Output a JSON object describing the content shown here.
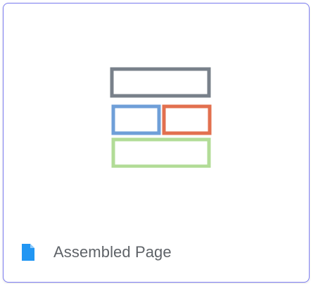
{
  "card": {
    "title": "Assembled Page",
    "file_icon": "document-icon",
    "preview_icon": "page-layout-icon"
  },
  "colors": {
    "card_border": "#7b7cf0",
    "label_text": "#5f6368",
    "file_icon": "#2196f3",
    "layout_header": "#78808a",
    "layout_left": "#6f9fd8",
    "layout_right": "#e2704f",
    "layout_footer": "#b2dc97"
  }
}
